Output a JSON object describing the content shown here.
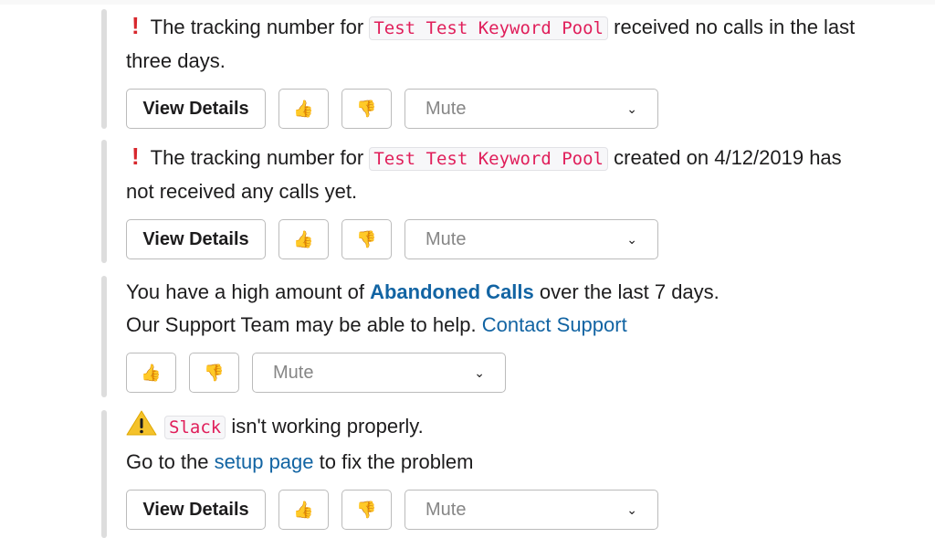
{
  "attachments": [
    {
      "icon": "exclamation-icon",
      "line1_prefix": "The tracking number for",
      "code": "Test Test Keyword Pool",
      "line1_suffix": "received no calls in the last",
      "line2": "three days.",
      "view_details": "View Details",
      "thumbs_up": "👍",
      "thumbs_down": "👎",
      "mute": "Mute"
    },
    {
      "icon": "exclamation-icon",
      "line1_prefix": "The tracking number for",
      "code": "Test Test Keyword Pool",
      "line1_suffix": "created on 4/12/2019 has",
      "line2": "not received any calls yet.",
      "view_details": "View Details",
      "thumbs_up": "👍",
      "thumbs_down": "👎",
      "mute": "Mute"
    },
    {
      "line1_prefix": "You have a high amount of",
      "link1": "Abandoned Calls",
      "line1_suffix": "over the last 7 days.",
      "line2_prefix": "Our Support Team may be able to help.",
      "link2": "Contact Support",
      "thumbs_up": "👍",
      "thumbs_down": "👎",
      "mute": "Mute"
    },
    {
      "icon": "warning-icon",
      "code": "Slack",
      "line1_suffix": "isn't working properly.",
      "line2_prefix": "Go to the",
      "link2": "setup page",
      "line2_suffix": "to fix the problem",
      "view_details": "View Details",
      "thumbs_up": "👍",
      "thumbs_down": "👎",
      "mute": "Mute"
    }
  ],
  "colors": {
    "code": "#e01e5a",
    "link": "#1264a3",
    "exclamation": "#d8272d",
    "bar": "#dddddd"
  }
}
